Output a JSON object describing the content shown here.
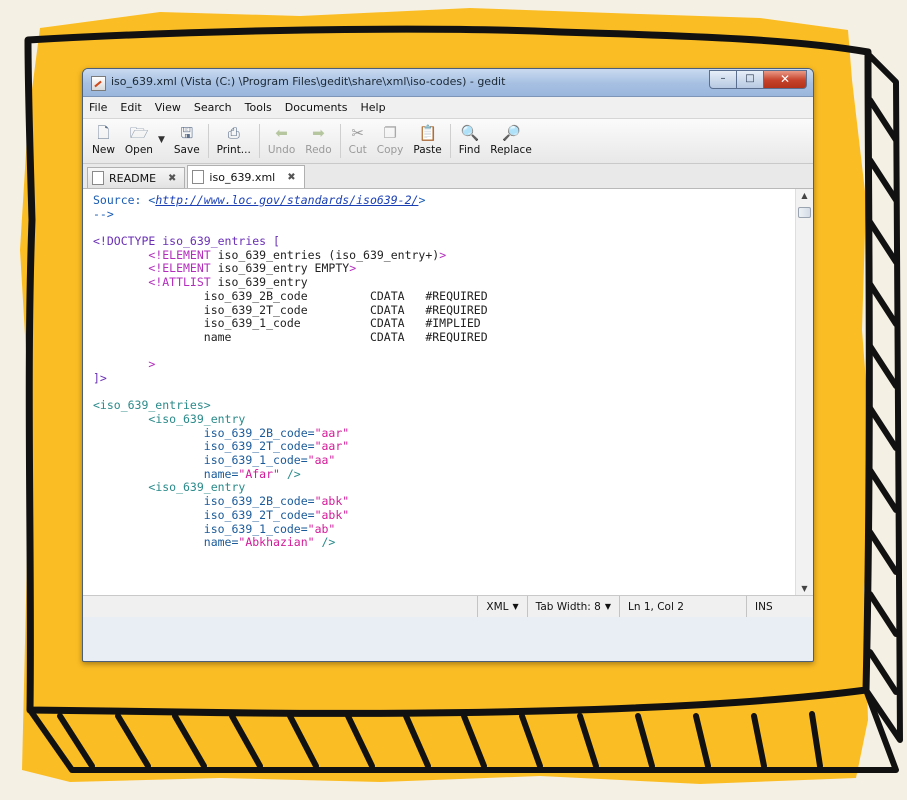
{
  "window": {
    "title": "iso_639.xml (Vista (C:) \\Program Files\\gedit\\share\\xml\\iso-codes) - gedit",
    "controls": {
      "minimize": "–",
      "maximize": "□",
      "close": "✕"
    }
  },
  "menubar": {
    "items": [
      {
        "label": "File"
      },
      {
        "label": "Edit"
      },
      {
        "label": "View"
      },
      {
        "label": "Search"
      },
      {
        "label": "Tools"
      },
      {
        "label": "Documents"
      },
      {
        "label": "Help"
      }
    ]
  },
  "toolbar": {
    "new_label": "New",
    "new_icon": "new-document-icon",
    "open_label": "Open",
    "open_icon": "folder-icon",
    "save_label": "Save",
    "save_icon": "floppy-icon",
    "print_label": "Print...",
    "print_icon": "printer-icon",
    "undo_label": "Undo",
    "undo_icon": "undo-arrow-icon",
    "redo_label": "Redo",
    "redo_icon": "redo-arrow-icon",
    "cut_label": "Cut",
    "cut_icon": "scissors-icon",
    "copy_label": "Copy",
    "copy_icon": "copy-icon",
    "paste_label": "Paste",
    "paste_icon": "clipboard-icon",
    "find_label": "Find",
    "find_icon": "magnifier-icon",
    "replace_label": "Replace",
    "replace_icon": "find-replace-icon"
  },
  "tabs": [
    {
      "label": "README",
      "active": false
    },
    {
      "label": "iso_639.xml",
      "active": true
    }
  ],
  "editor": {
    "lines": [
      [
        {
          "c": "src",
          "t": "Source: "
        },
        {
          "c": "url-l",
          "t": "<"
        },
        {
          "c": "url",
          "t": "http://www.loc.gov/standards/iso639-2/"
        },
        {
          "c": "url-l",
          "t": ">"
        }
      ],
      [
        {
          "c": "src",
          "t": "-->"
        }
      ],
      [],
      [
        {
          "c": "dt",
          "t": "<!DOCTYPE iso_639_entries ["
        }
      ],
      [
        {
          "c": "plain",
          "t": "        "
        },
        {
          "c": "kw",
          "t": "<!ELEMENT"
        },
        {
          "c": "plain",
          "t": " iso_639_entries (iso_639_entry+)"
        },
        {
          "c": "kw",
          "t": ">"
        }
      ],
      [
        {
          "c": "plain",
          "t": "        "
        },
        {
          "c": "kw",
          "t": "<!ELEMENT"
        },
        {
          "c": "plain",
          "t": " iso_639_entry EMPTY"
        },
        {
          "c": "kw",
          "t": ">"
        }
      ],
      [
        {
          "c": "plain",
          "t": "        "
        },
        {
          "c": "kw",
          "t": "<!ATTLIST"
        },
        {
          "c": "plain",
          "t": " iso_639_entry"
        }
      ],
      [
        {
          "c": "plain",
          "t": "                iso_639_2B_code         CDATA   #REQUIRED"
        }
      ],
      [
        {
          "c": "plain",
          "t": "                iso_639_2T_code         CDATA   #REQUIRED"
        }
      ],
      [
        {
          "c": "plain",
          "t": "                iso_639_1_code          CDATA   #IMPLIED"
        }
      ],
      [
        {
          "c": "plain",
          "t": "                name                    CDATA   #REQUIRED"
        }
      ],
      [],
      [
        {
          "c": "plain",
          "t": "        "
        },
        {
          "c": "kw",
          "t": ">"
        }
      ],
      [
        {
          "c": "dt",
          "t": "]>"
        }
      ],
      [],
      [
        {
          "c": "tag",
          "t": "<iso_639_entries>"
        }
      ],
      [
        {
          "c": "plain",
          "t": "        "
        },
        {
          "c": "tag",
          "t": "<iso_639_entry"
        }
      ],
      [
        {
          "c": "plain",
          "t": "                "
        },
        {
          "c": "attr",
          "t": "iso_639_2B_code="
        },
        {
          "c": "str",
          "t": "\"aar\""
        }
      ],
      [
        {
          "c": "plain",
          "t": "                "
        },
        {
          "c": "attr",
          "t": "iso_639_2T_code="
        },
        {
          "c": "str",
          "t": "\"aar\""
        }
      ],
      [
        {
          "c": "plain",
          "t": "                "
        },
        {
          "c": "attr",
          "t": "iso_639_1_code="
        },
        {
          "c": "str",
          "t": "\"aa\""
        }
      ],
      [
        {
          "c": "plain",
          "t": "                "
        },
        {
          "c": "attr",
          "t": "name="
        },
        {
          "c": "str",
          "t": "\"Afar\""
        },
        {
          "c": "tag",
          "t": " />"
        }
      ],
      [
        {
          "c": "plain",
          "t": "        "
        },
        {
          "c": "tag",
          "t": "<iso_639_entry"
        }
      ],
      [
        {
          "c": "plain",
          "t": "                "
        },
        {
          "c": "attr",
          "t": "iso_639_2B_code="
        },
        {
          "c": "str",
          "t": "\"abk\""
        }
      ],
      [
        {
          "c": "plain",
          "t": "                "
        },
        {
          "c": "attr",
          "t": "iso_639_2T_code="
        },
        {
          "c": "str",
          "t": "\"abk\""
        }
      ],
      [
        {
          "c": "plain",
          "t": "                "
        },
        {
          "c": "attr",
          "t": "iso_639_1_code="
        },
        {
          "c": "str",
          "t": "\"ab\""
        }
      ],
      [
        {
          "c": "plain",
          "t": "                "
        },
        {
          "c": "attr",
          "t": "name="
        },
        {
          "c": "str",
          "t": "\"Abkhazian\""
        },
        {
          "c": "tag",
          "t": " />"
        }
      ]
    ]
  },
  "statusbar": {
    "language": "XML",
    "tab_width": "Tab Width: 8",
    "position": "Ln 1, Col 2",
    "mode": "INS"
  },
  "colors": {
    "frame_yellow": "#fbbd24",
    "frame_ink": "#111111",
    "background": "#f5f0e4"
  }
}
